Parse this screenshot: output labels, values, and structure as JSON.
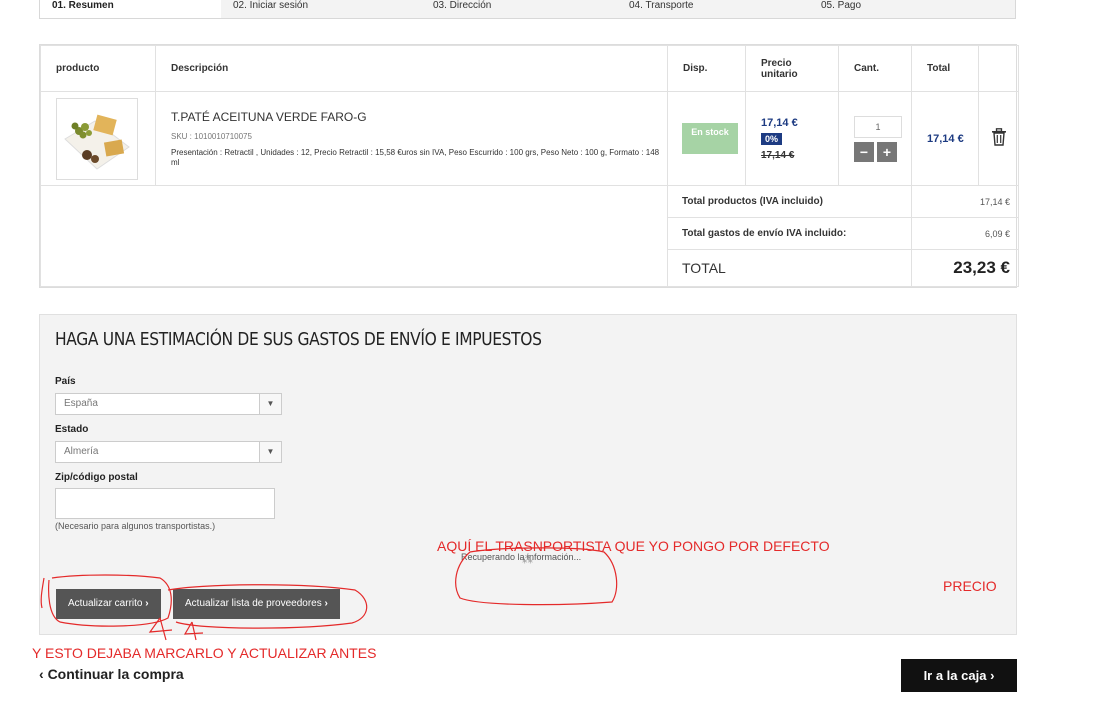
{
  "steps": [
    "01. Resumen",
    "02. Iniciar sesión",
    "03. Dirección",
    "04. Transporte",
    "05. Pago"
  ],
  "cart": {
    "headers": {
      "product": "producto",
      "description": "Descripción",
      "availability": "Disp.",
      "unit_price": "Precio unitario",
      "qty": "Cant.",
      "total": "Total"
    },
    "item": {
      "name": "T.PATÉ ACEITUNA VERDE FARO-G",
      "sku": "SKU : 1010010710075",
      "attributes": "Presentación : Retractil , Unidades : 12, Precio Retractil : 15,58 €uros sin IVA, Peso Escurrido : 100 grs, Peso Neto : 100 g, Formato : 148 ml",
      "stock": "En stock",
      "price": "17,14 €",
      "discount": "0%",
      "old_price": "17,14 €",
      "quantity": "1",
      "minus": "−",
      "plus": "+",
      "line_total": "17,14 €"
    },
    "summary": {
      "products_label": "Total productos (IVA incluido)",
      "products_value": "17,14 €",
      "shipping_label": "Total gastos de envío IVA incluido:",
      "shipping_value": "6,09 €",
      "total_label": "TOTAL",
      "total_value": "23,23 €"
    }
  },
  "estimate": {
    "title": "HAGA UNA ESTIMACIÓN DE SUS GASTOS DE ENVÍO E IMPUESTOS",
    "country_label": "País",
    "country_value": "España",
    "state_label": "Estado",
    "state_value": "Almería",
    "zip_label": "Zip/código postal",
    "zip_value": "",
    "hint": "(Necesario para algunos transportistas.)",
    "update_cart": "Actualizar carrito",
    "update_carriers": "Actualizar lista de proveedores",
    "loading": "Recuperando la información..."
  },
  "annotations": {
    "carrier_note": "AQUÍ EL TRASNPORTISTA QUE YO PONGO POR DEFECTO",
    "price_note": "PRECIO",
    "mark_note": "Y ESTO DEJABA MARCARLO Y ACTUALIZAR ANTES"
  },
  "footer": {
    "continue": "Continuar la compra",
    "checkout": "Ir a la caja"
  },
  "colors": {
    "accent_blue": "#1d3b82",
    "stock_green": "#a6d3a5",
    "annotation_red": "#e42a2a"
  }
}
